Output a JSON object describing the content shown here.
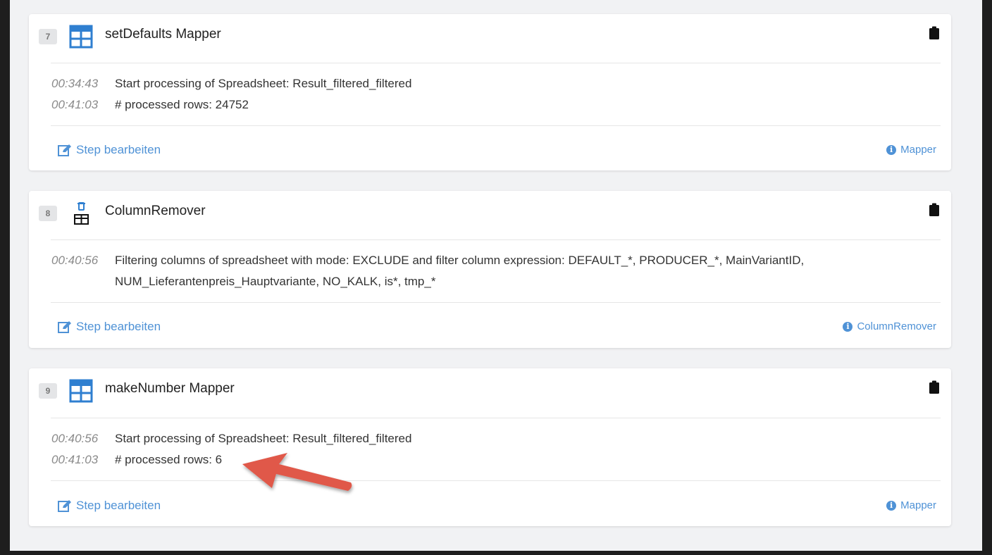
{
  "accent_color": "#4f92d6",
  "steps": [
    {
      "number": "7",
      "icon": "table-icon",
      "title": "setDefaults Mapper",
      "logs": [
        {
          "time": "00:34:43",
          "message": "Start processing of Spreadsheet: Result_filtered_filtered"
        },
        {
          "time": "00:41:03",
          "message": "# processed rows: 24752"
        }
      ],
      "edit_label": "Step bearbeiten",
      "type_label": "Mapper"
    },
    {
      "number": "8",
      "icon": "column-remover-icon",
      "title": "ColumnRemover",
      "logs": [
        {
          "time": "00:40:56",
          "message": "Filtering columns of spreadsheet with mode: EXCLUDE and filter column expression: DEFAULT_*, PRODUCER_*, MainVariantID, NUM_Lieferantenpreis_Hauptvariante, NO_KALK, is*, tmp_*"
        }
      ],
      "edit_label": "Step bearbeiten",
      "type_label": "ColumnRemover"
    },
    {
      "number": "9",
      "icon": "table-icon",
      "title": "makeNumber Mapper",
      "logs": [
        {
          "time": "00:40:56",
          "message": "Start processing of Spreadsheet: Result_filtered_filtered"
        },
        {
          "time": "00:41:03",
          "message": "# processed rows: 6"
        }
      ],
      "edit_label": "Step bearbeiten",
      "type_label": "Mapper"
    }
  ],
  "annotation": {
    "icon": "arrow-annotation",
    "color": "#e0584a"
  }
}
